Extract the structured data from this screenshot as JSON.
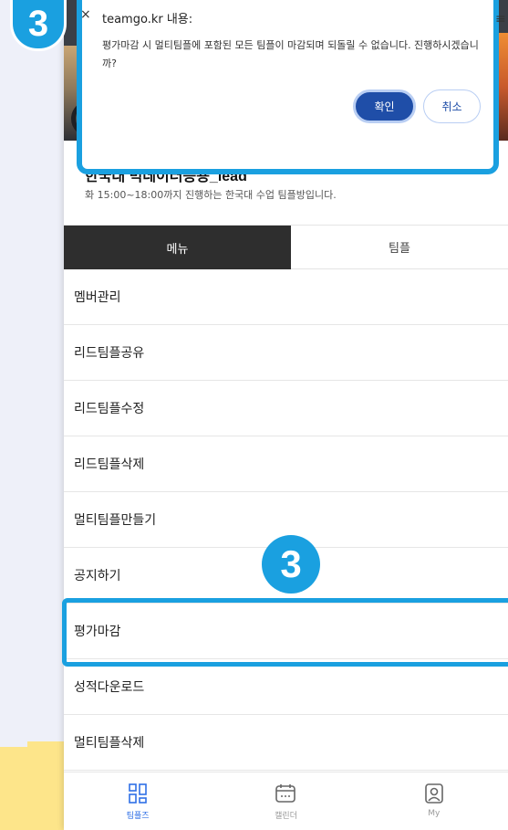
{
  "dialog": {
    "title": "teamgo.kr 내용:",
    "message": "평가마감 시 멀티팀플에 포함된 모든 팀플이 마감되며 되돌릴 수 없습니다. 진행하시겠습니까?",
    "ok_label": "확인",
    "cancel_label": "취소"
  },
  "room": {
    "title": "한국대 빅데이터응용_lead",
    "description": "화 15:00~18:00까지 진행하는 한국대 수업 팀플방입니다."
  },
  "tabs": [
    {
      "label": "메뉴",
      "active": true
    },
    {
      "label": "팀플",
      "active": false
    }
  ],
  "menu": {
    "items": [
      {
        "label": "멤버관리"
      },
      {
        "label": "리드팀플공유"
      },
      {
        "label": "리드팀플수정"
      },
      {
        "label": "리드팀플삭제"
      },
      {
        "label": "멀티팀플만들기"
      },
      {
        "label": "공지하기"
      },
      {
        "label": "평가마감"
      },
      {
        "label": "성적다운로드"
      },
      {
        "label": "멀티팀플삭제"
      }
    ]
  },
  "bottom_nav": [
    {
      "label": "팀플즈",
      "icon": "grid-icon",
      "active": true
    },
    {
      "label": "캘린더",
      "icon": "calendar-icon",
      "active": false
    },
    {
      "label": "My",
      "icon": "user-icon",
      "active": false
    }
  ],
  "badges": {
    "top": "3",
    "middle": "3"
  },
  "colors": {
    "accent": "#1aa0e0",
    "primary_button": "#1f4ea8",
    "active_tab": "#2e2e2e",
    "nav_active": "#2f6fe6"
  }
}
